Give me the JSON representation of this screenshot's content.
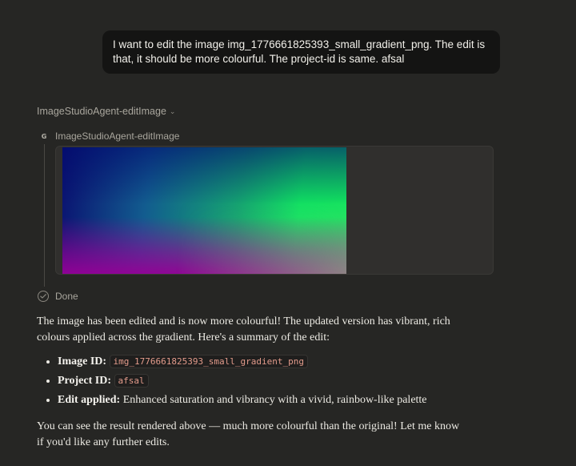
{
  "user_message": {
    "line1": "I want to edit the image img_1776661825393_small_gradient_png. The edit is",
    "line2": "that, it should be more colourful. The project-id is same. afsal"
  },
  "tool_call": {
    "header": "ImageStudioAgent-editImage",
    "icon_letter": "G",
    "name": "ImageStudioAgent-editImage",
    "status": "Done"
  },
  "response": {
    "intro_line1": "The image has been edited and is now more colourful! The updated version has vibrant, rich",
    "intro_line2": "colours applied across the gradient. Here's a summary of the edit:",
    "items": [
      {
        "label": "Image ID:",
        "value": "img_1776661825393_small_gradient_png"
      },
      {
        "label": "Project ID:",
        "value": "afsal"
      },
      {
        "label": "Edit applied:",
        "value": "Enhanced saturation and vibrancy with a vivid, rainbow-like palette"
      }
    ],
    "closing_line1": "You can see the result rendered above — much more colourful than the original! Let me know",
    "closing_line2": "if you'd like any further edits."
  }
}
